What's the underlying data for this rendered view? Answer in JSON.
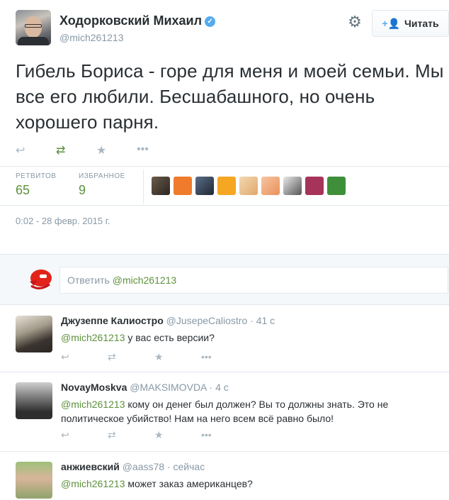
{
  "header": {
    "name": "Ходорковский Михаил",
    "verified_icon": "verified-check",
    "handle": "@mich261213",
    "follow_label": "Читать"
  },
  "tweet": {
    "text": "Гибель Бориса - горе для меня и моей семьи. Мы все его любили. Бесшабашного, но очень хорошего парня.",
    "actions": [
      "reply-icon",
      "retweet-icon",
      "favorite-icon",
      "more-icon"
    ],
    "retweets_label": "РЕТВИТОВ",
    "retweets_count": "65",
    "favorites_label": "ИЗБРАННОЕ",
    "favorites_count": "9",
    "timestamp": "0:02 - 28 февр. 2015 г."
  },
  "reply_box": {
    "placeholder_prefix": "Ответить ",
    "placeholder_mention": "@mich261213"
  },
  "replies": [
    {
      "name": "Джузеппе Калиостро",
      "handle": "@JusepeCaliostro",
      "time": "· 41 с",
      "mention": "@mich261213",
      "text": " у вас есть версии?"
    },
    {
      "name": "NovayMoskva",
      "handle": "@MAKSIMOVDA",
      "time": "· 4 с",
      "mention": "@mich261213",
      "text": " кому он денег был должен? Вы то должны знать. Это не политическое убийство! Нам на него всем всё равно было!"
    },
    {
      "name": "анжиевский",
      "handle": "@aass78",
      "time": "· сейчас",
      "mention": "@mich261213",
      "text": " может заказ американцев?"
    }
  ],
  "colors": {
    "accent_green": "#5c913b",
    "link_blue": "#55acee",
    "muted": "#8899a6"
  }
}
